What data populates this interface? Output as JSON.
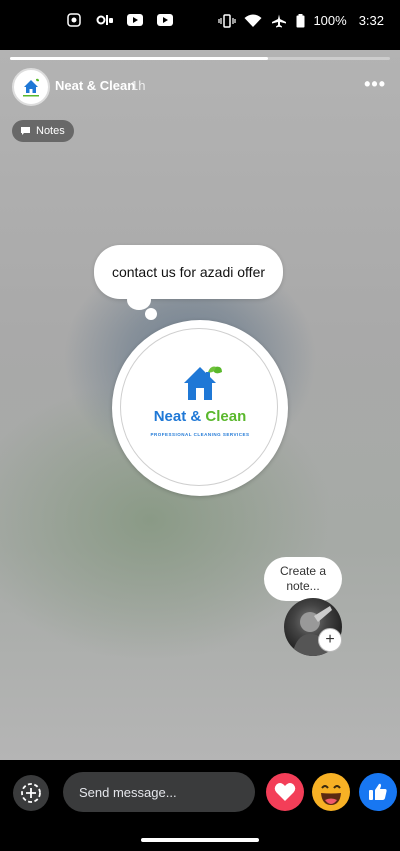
{
  "status_bar": {
    "battery": "100%",
    "time": "3:32"
  },
  "story": {
    "progress": 0.68,
    "page_name": "Neat & Clean",
    "time_ago": "1h",
    "more_label": "•••",
    "notes_chip_label": "Notes",
    "note_bubble_text": "contact us for azadi offer",
    "logo": {
      "title_part1": "Neat",
      "title_amp": " & ",
      "title_part2": "Clean",
      "subtitle": "PROFESSIONAL CLEANING SERVICES"
    },
    "create_note_label": "Create a note...",
    "plus_label": "+"
  },
  "bottom_bar": {
    "message_placeholder": "Send message..."
  },
  "colors": {
    "brand_blue": "#1f78d6",
    "brand_green": "#5ab82c",
    "love": "#f33e58",
    "haha": "#f7b125",
    "like": "#1877f2"
  }
}
